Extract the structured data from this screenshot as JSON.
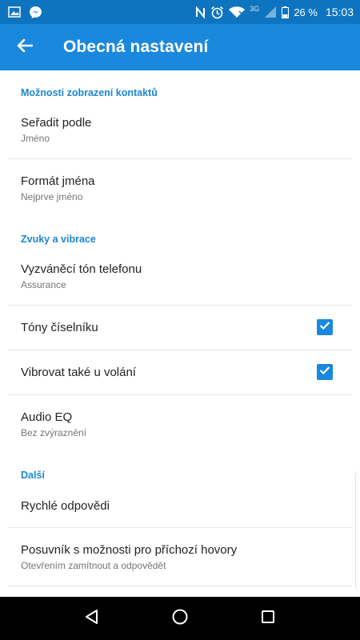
{
  "status_bar": {
    "network": "3G",
    "battery": "26 %",
    "time": "15:03",
    "icons": [
      "image-icon",
      "messenger-icon",
      "nfc-icon",
      "alarm-icon",
      "wifi-icon",
      "signal-icon",
      "battery-icon"
    ]
  },
  "app_bar": {
    "title": "Obecná nastavení",
    "back_icon": "arrow-left-icon"
  },
  "sections": [
    {
      "header": "Možnosti zobrazení kontaktů",
      "items": [
        {
          "title": "Seřadit podle",
          "subtitle": "Jméno"
        },
        {
          "title": "Formát jména",
          "subtitle": "Nejprve jméno"
        }
      ]
    },
    {
      "header": "Zvuky a vibrace",
      "items": [
        {
          "title": "Vyzváněcí tón telefonu",
          "subtitle": "Assurance"
        },
        {
          "title": "Tóny číselníku",
          "checked": true
        },
        {
          "title": "Vibrovat také u volání",
          "checked": true
        },
        {
          "title": "Audio EQ",
          "subtitle": "Bez zvýraznění"
        }
      ]
    },
    {
      "header": "Další",
      "items": [
        {
          "title": "Rychlé odpovědi"
        },
        {
          "title": "Posuvník s možnosti pro příchozí hovory",
          "subtitle": "Otevřením zamítnout a odpovědět"
        }
      ]
    }
  ],
  "nav_bar": {
    "icons": [
      "back-triangle-icon",
      "home-circle-icon",
      "recents-square-icon"
    ]
  },
  "colors": {
    "status_bar": "#0f74bf",
    "app_bar": "#1a88dc",
    "accent": "#1b86d4"
  }
}
